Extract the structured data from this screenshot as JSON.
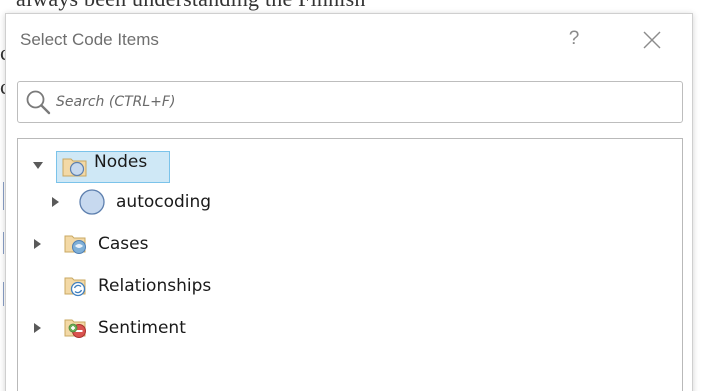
{
  "background": {
    "doc_text": "always been understanding the Finnish",
    "left_marks": [
      "c",
      "c"
    ]
  },
  "dialog": {
    "title": "Select Code Items",
    "help_label": "?"
  },
  "search": {
    "placeholder": "Search (CTRL+F)",
    "value": ""
  },
  "tree": {
    "items": [
      {
        "label": "Nodes",
        "icon": "folder-nodes-icon",
        "expanded": true,
        "selected": true
      },
      {
        "label": "autocoding",
        "icon": "node-circle-icon",
        "expanded": false,
        "selected": false
      },
      {
        "label": "Cases",
        "icon": "cases-folder-icon",
        "expanded": false,
        "selected": false
      },
      {
        "label": "Relationships",
        "icon": "relationships-folder-icon",
        "expanded": false,
        "selected": false
      },
      {
        "label": "Sentiment",
        "icon": "sentiment-folder-icon",
        "expanded": false,
        "selected": false
      }
    ]
  },
  "colors": {
    "selection_fill": "#cfe8f6",
    "selection_border": "#7bc3ea",
    "node_circle_fill": "#c7d9ef",
    "node_circle_stroke": "#5d7fae"
  }
}
